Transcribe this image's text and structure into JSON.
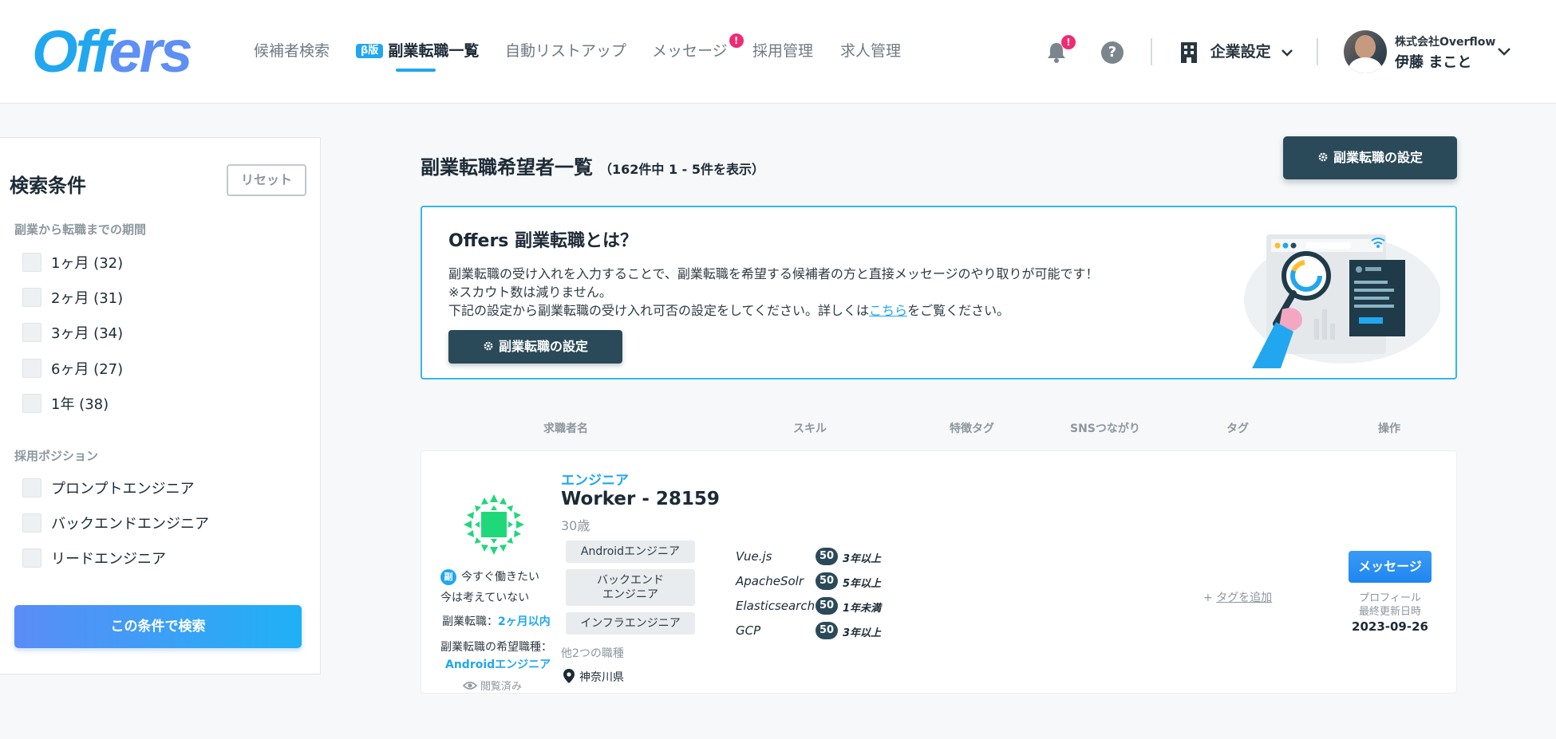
{
  "brand": {
    "logo_main": "Off",
    "logo_tail": "ers",
    "primary_color": "#20a7ef",
    "dark_color": "#2b4a59",
    "alert_color": "#ef2b74"
  },
  "nav": {
    "items": [
      {
        "label": "候補者検索"
      },
      {
        "badge": "β版",
        "label": "副業転職一覧",
        "active": true
      },
      {
        "label": "自動リストアップ"
      },
      {
        "label": "メッセージ",
        "alert": "!"
      },
      {
        "label": "採用管理"
      },
      {
        "label": "求人管理"
      }
    ]
  },
  "header": {
    "bell_icon": "bell-icon",
    "bell_alert": "!",
    "help_label": "?",
    "company_settings_label": "企業設定",
    "user_company": "株式会社Overflow",
    "user_name": "伊藤 まこと"
  },
  "sidebar": {
    "title": "検索条件",
    "reset_label": "リセット",
    "period_section": "副業から転職までの期間",
    "period_options": [
      {
        "label": "1ヶ月 (32)"
      },
      {
        "label": "2ヶ月 (31)"
      },
      {
        "label": "3ヶ月 (34)"
      },
      {
        "label": "6ヶ月 (27)"
      },
      {
        "label": "1年 (38)"
      }
    ],
    "position_section": "採用ポジション",
    "position_options": [
      {
        "label": "プロンプトエンジニア"
      },
      {
        "label": "バックエンドエンジニア"
      },
      {
        "label": "リードエンジニア"
      }
    ],
    "search_button": "この条件で検索"
  },
  "main": {
    "title": "副業転職希望者一覧",
    "count_text": "（162件中 1 - 5件を表示）",
    "settings_button": "副業転職の設定",
    "info": {
      "title": "Offers 副業転職とは？",
      "line1": "副業転職の受け入れを入力することで、副業転職を希望する候補者の方と直接メッセージのやり取りが可能です！",
      "line2": "※スカウト数は減りません。",
      "line3_before": "下記の設定から副業転職の受け入れ可否の設定をしてください。詳しくは",
      "line3_link": "こちら",
      "line3_after": "をご覧ください。",
      "button": "副業転職の設定"
    },
    "columns": [
      "求職者名",
      "スキル",
      "特徴タグ",
      "SNSつながり",
      "タグ",
      "操作"
    ]
  },
  "candidate": {
    "role": "エンジニア",
    "name": "Worker - 28159",
    "age": "30歳",
    "urgency_badge": "副",
    "urgency_line1": "今すぐ働きたい",
    "urgency_line2": "今は考えていない",
    "period_label": "副業転職：",
    "period_value": "2ヶ月以内",
    "desired_label": "副業転職の希望職種：",
    "desired_value": "Androidエンジニア",
    "viewed": "閲覧済み",
    "job_tags": [
      "Androidエンジニア",
      "バックエンド\nエンジニア",
      "インフラエンジニア"
    ],
    "job_more": "他2つの職種",
    "location": "神奈川県",
    "skills": [
      {
        "name": "Vue.js",
        "level": "50",
        "years": "3年以上"
      },
      {
        "name": "ApacheSolr",
        "level": "50",
        "years": "5年以上"
      },
      {
        "name": "Elasticsearch",
        "level": "50",
        "years": "1年未満"
      },
      {
        "name": "GCP",
        "level": "50",
        "years": "3年以上"
      }
    ],
    "add_tag_plus": "+",
    "add_tag": "タグを追加",
    "message_button": "メッセージ",
    "profile_label": "プロフィール\n最終更新日時",
    "profile_date": "2023-09-26"
  }
}
